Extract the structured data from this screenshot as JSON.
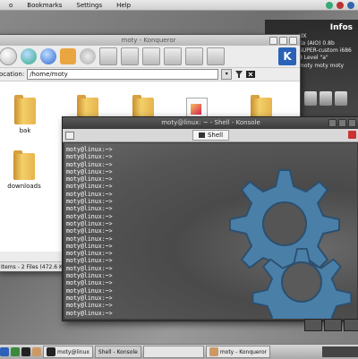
{
  "menubar": {
    "items": [
      "o",
      "Bookmarks",
      "Settings",
      "Help"
    ]
  },
  "infos": {
    "title": "Infos",
    "lines": [
      "UX",
      "Ko (AIO) 0.8b",
      "SUPER-custom i686",
      "3 Level \"a\"",
      "",
      "moty moty moty"
    ]
  },
  "konqueror": {
    "title": "moty - Konqueror",
    "location_label": "ocation:",
    "location_value": "/home/moty",
    "files": [
      {
        "name": "bak",
        "kind": "folder"
      },
      {
        "name": "",
        "kind": "folder"
      },
      {
        "name": "",
        "kind": "folder"
      },
      {
        "name": "",
        "kind": "document"
      },
      {
        "name": "",
        "kind": "folder"
      },
      {
        "name": "downloads",
        "kind": "folder"
      }
    ],
    "status": "Items - 2 Files (472.6 K"
  },
  "konsole": {
    "title": "moty@linux: ~ - Shell - Konsole",
    "tab_label": "Shell",
    "prompt": "moty@linux:~>",
    "prompt_lines": 23
  },
  "taskbar": {
    "tasks": [
      {
        "label": "moty@linux",
        "active": false
      },
      {
        "label": "Shell - Konsole",
        "active": true
      },
      {
        "label": "",
        "active": false
      },
      {
        "label": "moty - Konqueror",
        "active": false
      }
    ]
  },
  "colors": {
    "kde_blue": "#2a62b8",
    "gear": "#4a7fa8",
    "terminal_text": "#ffffff"
  }
}
